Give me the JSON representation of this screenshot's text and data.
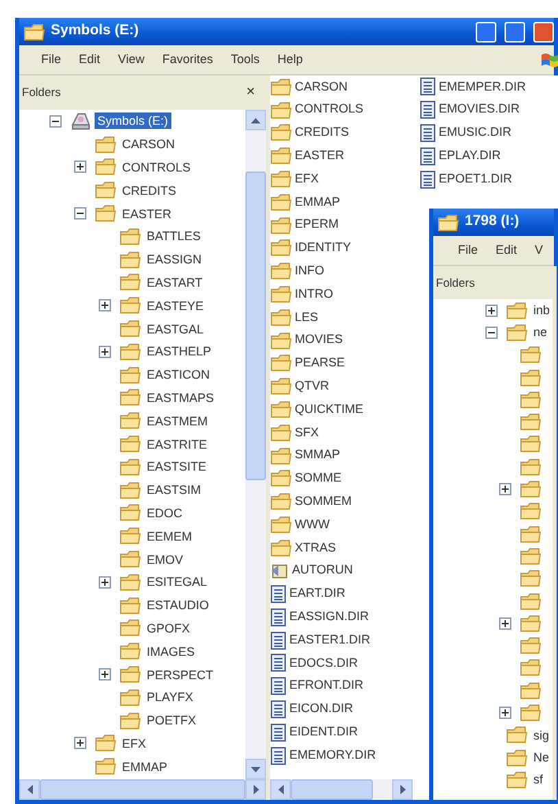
{
  "main_window": {
    "title": "Symbols (E:)",
    "menu": [
      "File",
      "Edit",
      "View",
      "Favorites",
      "Tools",
      "Help"
    ],
    "folders_pane": {
      "title": "Folders",
      "close": "×",
      "tree": [
        {
          "label": "Symbols (E:)",
          "kind": "drive",
          "expandable": true,
          "expanded": true,
          "selected": true,
          "children": [
            {
              "label": "CARSON",
              "kind": "folder",
              "expandable": false,
              "selected": false
            },
            {
              "label": "CONTROLS",
              "kind": "folder",
              "expandable": true,
              "expanded": false,
              "selected": false
            },
            {
              "label": "CREDITS",
              "kind": "folder",
              "expandable": false,
              "selected": false
            },
            {
              "label": "EASTER",
              "kind": "folder",
              "expandable": true,
              "expanded": true,
              "selected": false,
              "children": [
                {
                  "label": "BATTLES",
                  "kind": "folder",
                  "expandable": false,
                  "selected": false
                },
                {
                  "label": "EASSIGN",
                  "kind": "folder",
                  "expandable": false,
                  "selected": false
                },
                {
                  "label": "EASTART",
                  "kind": "folder",
                  "expandable": false,
                  "selected": false
                },
                {
                  "label": "EASTEYE",
                  "kind": "folder",
                  "expandable": true,
                  "expanded": false,
                  "selected": false
                },
                {
                  "label": "EASTGAL",
                  "kind": "folder",
                  "expandable": false,
                  "selected": false
                },
                {
                  "label": "EASTHELP",
                  "kind": "folder",
                  "expandable": true,
                  "expanded": false,
                  "selected": false
                },
                {
                  "label": "EASTICON",
                  "kind": "folder",
                  "expandable": false,
                  "selected": false
                },
                {
                  "label": "EASTMAPS",
                  "kind": "folder",
                  "expandable": false,
                  "selected": false
                },
                {
                  "label": "EASTMEM",
                  "kind": "folder",
                  "expandable": false,
                  "selected": false
                },
                {
                  "label": "EASTRITE",
                  "kind": "folder",
                  "expandable": false,
                  "selected": false
                },
                {
                  "label": "EASTSITE",
                  "kind": "folder",
                  "expandable": false,
                  "selected": false
                },
                {
                  "label": "EASTSIM",
                  "kind": "folder",
                  "expandable": false,
                  "selected": false
                },
                {
                  "label": "EDOC",
                  "kind": "folder",
                  "expandable": false,
                  "selected": false
                },
                {
                  "label": "EEMEM",
                  "kind": "folder",
                  "expandable": false,
                  "selected": false
                },
                {
                  "label": "EMOV",
                  "kind": "folder",
                  "expandable": false,
                  "selected": false
                },
                {
                  "label": "ESITEGAL",
                  "kind": "folder",
                  "expandable": true,
                  "expanded": false,
                  "selected": false
                },
                {
                  "label": "ESTAUDIO",
                  "kind": "folder",
                  "expandable": false,
                  "selected": false
                },
                {
                  "label": "GPOFX",
                  "kind": "folder",
                  "expandable": false,
                  "selected": false
                },
                {
                  "label": "IMAGES",
                  "kind": "folder",
                  "expandable": false,
                  "selected": false
                },
                {
                  "label": "PERSPECT",
                  "kind": "folder",
                  "expandable": true,
                  "expanded": false,
                  "selected": false
                },
                {
                  "label": "PLAYFX",
                  "kind": "folder",
                  "expandable": false,
                  "selected": false
                },
                {
                  "label": "POETFX",
                  "kind": "folder",
                  "expandable": false,
                  "selected": false
                }
              ]
            },
            {
              "label": "EFX",
              "kind": "folder",
              "expandable": true,
              "expanded": false,
              "selected": false
            },
            {
              "label": "EMMAP",
              "kind": "folder",
              "expandable": false,
              "selected": false
            }
          ]
        }
      ]
    },
    "file_list": {
      "columns": [
        {
          "items": [
            {
              "name": "CARSON",
              "kind": "folder"
            },
            {
              "name": "CONTROLS",
              "kind": "folder"
            },
            {
              "name": "CREDITS",
              "kind": "folder"
            },
            {
              "name": "EASTER",
              "kind": "folder"
            },
            {
              "name": "EFX",
              "kind": "folder"
            },
            {
              "name": "EMMAP",
              "kind": "folder"
            },
            {
              "name": "EPERM",
              "kind": "folder"
            },
            {
              "name": "IDENTITY",
              "kind": "folder"
            },
            {
              "name": "INFO",
              "kind": "folder"
            },
            {
              "name": "INTRO",
              "kind": "folder"
            },
            {
              "name": "LES",
              "kind": "folder"
            },
            {
              "name": "MOVIES",
              "kind": "folder"
            },
            {
              "name": "PEARSE",
              "kind": "folder"
            },
            {
              "name": "QTVR",
              "kind": "folder"
            },
            {
              "name": "QUICKTIME",
              "kind": "folder"
            },
            {
              "name": "SFX",
              "kind": "folder"
            },
            {
              "name": "SMMAP",
              "kind": "folder"
            },
            {
              "name": "SOMME",
              "kind": "folder"
            },
            {
              "name": "SOMMEM",
              "kind": "folder"
            },
            {
              "name": "WWW",
              "kind": "folder"
            },
            {
              "name": "XTRAS",
              "kind": "folder"
            },
            {
              "name": "AUTORUN",
              "kind": "program"
            },
            {
              "name": "EART.DIR",
              "kind": "file"
            },
            {
              "name": "EASSIGN.DIR",
              "kind": "file"
            },
            {
              "name": "EASTER1.DIR",
              "kind": "file"
            },
            {
              "name": "EDOCS.DIR",
              "kind": "file"
            },
            {
              "name": "EFRONT.DIR",
              "kind": "file"
            },
            {
              "name": "EICON.DIR",
              "kind": "file"
            },
            {
              "name": "EIDENT.DIR",
              "kind": "file"
            },
            {
              "name": "EMEMORY.DIR",
              "kind": "file"
            }
          ]
        },
        {
          "items": [
            {
              "name": "EMEMPER.DIR",
              "kind": "file"
            },
            {
              "name": "EMOVIES.DIR",
              "kind": "file"
            },
            {
              "name": "EMUSIC.DIR",
              "kind": "file"
            },
            {
              "name": "EPLAY.DIR",
              "kind": "file"
            },
            {
              "name": "EPOET1.DIR",
              "kind": "file"
            }
          ]
        }
      ]
    }
  },
  "second_window": {
    "title": "1798 (I:)",
    "menu": [
      "File",
      "Edit",
      "V"
    ],
    "folders_pane": {
      "title": "Folders",
      "tree": [
        {
          "label": "inb",
          "kind": "folder",
          "expandable": true,
          "expanded": false,
          "selected": false
        },
        {
          "label": "ne",
          "kind": "folder",
          "expandable": true,
          "expanded": true,
          "selected": false,
          "children": [
            {
              "kind": "folder",
              "expandable": false,
              "selected": false
            },
            {
              "kind": "folder",
              "expandable": false,
              "selected": false
            },
            {
              "kind": "folder",
              "expandable": false,
              "selected": false
            },
            {
              "kind": "folder",
              "expandable": false,
              "selected": false
            },
            {
              "kind": "folder",
              "expandable": false,
              "selected": false
            },
            {
              "kind": "folder",
              "expandable": false,
              "selected": false
            },
            {
              "kind": "folder",
              "expandable": true,
              "expanded": false,
              "selected": false
            },
            {
              "kind": "folder",
              "expandable": false,
              "selected": false
            },
            {
              "kind": "folder",
              "expandable": false,
              "selected": false
            },
            {
              "kind": "folder",
              "expandable": false,
              "selected": false
            },
            {
              "kind": "folder",
              "expandable": false,
              "selected": false
            },
            {
              "kind": "folder",
              "expandable": false,
              "selected": false
            },
            {
              "kind": "folder",
              "expandable": true,
              "expanded": false,
              "selected": false
            },
            {
              "kind": "folder",
              "expandable": false,
              "selected": false
            },
            {
              "kind": "folder",
              "expandable": false,
              "selected": false
            },
            {
              "kind": "folder",
              "expandable": false,
              "selected": false
            },
            {
              "kind": "folder",
              "expandable": true,
              "expanded": false,
              "selected": false
            }
          ]
        },
        {
          "label": "sig",
          "kind": "folder",
          "expandable": false,
          "selected": false
        },
        {
          "label": "Ne",
          "kind": "folder",
          "expandable": false,
          "selected": false
        },
        {
          "label": "sf",
          "kind": "folder",
          "expandable": false,
          "selected": false
        }
      ]
    }
  }
}
